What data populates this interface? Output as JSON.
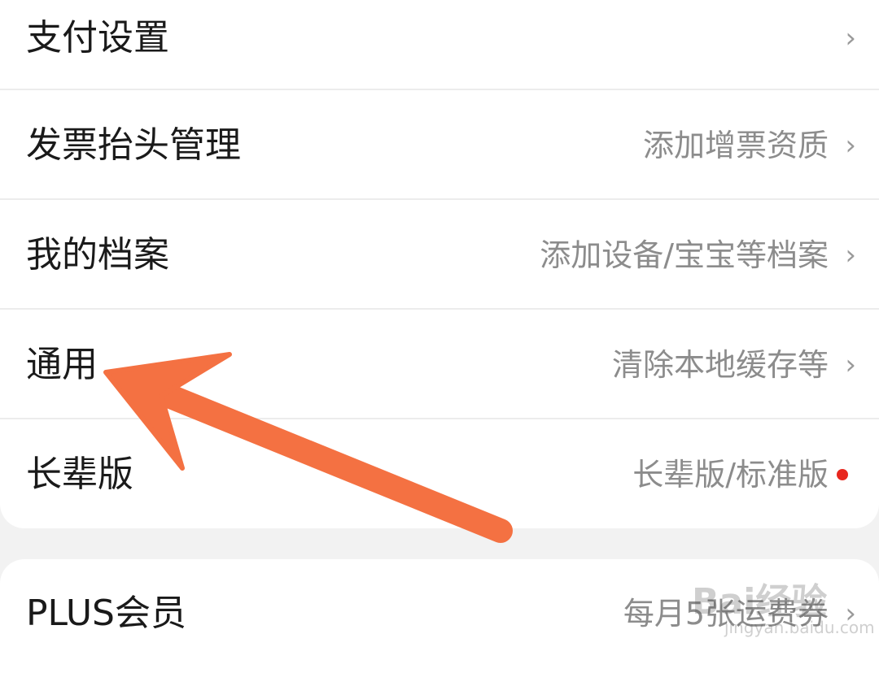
{
  "settings": {
    "items": [
      {
        "label": "支付设置",
        "value": ""
      },
      {
        "label": "发票抬头管理",
        "value": "添加增票资质"
      },
      {
        "label": "我的档案",
        "value": "添加设备/宝宝等档案"
      },
      {
        "label": "通用",
        "value": "清除本地缓存等"
      },
      {
        "label": "长辈版",
        "value": "长辈版/标准版"
      }
    ],
    "chevron": "›"
  },
  "plus": {
    "label": "PLUS会员",
    "value": "每月5张运费券"
  },
  "watermark": {
    "brand": "Bai经验",
    "site": "jingyan.baidu.com"
  },
  "colors": {
    "arrow": "#f47142",
    "notification_dot": "#e8271e"
  }
}
